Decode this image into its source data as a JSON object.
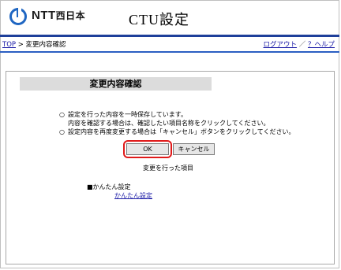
{
  "header": {
    "logo_main": "NTT",
    "logo_sub": "西日本",
    "app_title": "CTU設定",
    "accent_color": "#1e3f9a",
    "logo_color": "#1f66c2"
  },
  "nav": {
    "breadcrumb_top": "TOP",
    "breadcrumb_sep": " > ",
    "breadcrumb_current": "変更内容確認",
    "logout": "ログアウト",
    "separator": "／",
    "help": "？ヘルプ"
  },
  "main": {
    "title": "変更内容確認",
    "note1_bullet": "○",
    "note1_line1": "設定を行った内容を一時保存しています。",
    "note1_line2": "内容を確認する場合は、確認したい項目名称をクリックしてください。",
    "note2_bullet": "○",
    "note2_line1": "設定内容を再度変更する場合は「キャンセル」ボタンをクリックしてください。",
    "ok_label": "OK",
    "cancel_label": "キャンセル",
    "changed_items_label": "変更を行った項目",
    "section_heading": "■かんたん設定",
    "section_link": "かんたん設定",
    "highlight_color": "#e01a1a"
  }
}
